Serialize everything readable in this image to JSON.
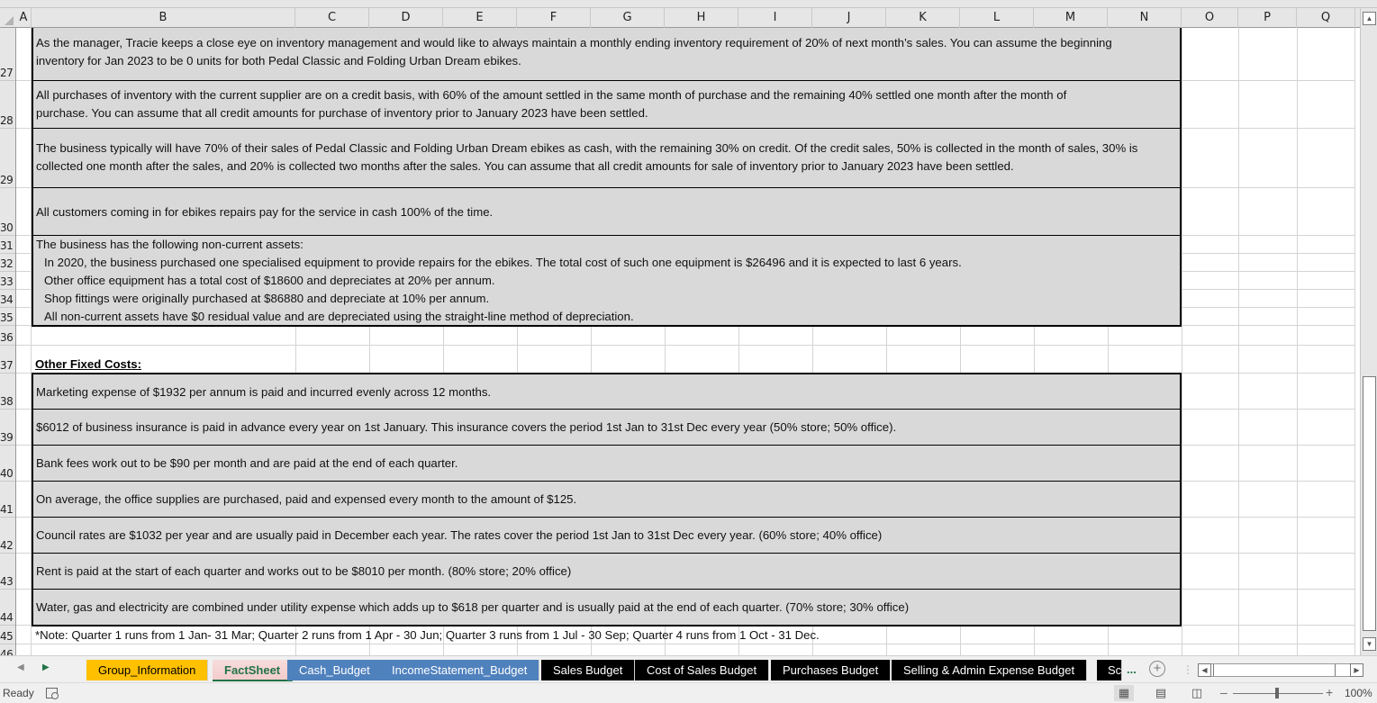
{
  "columns": [
    "A",
    "B",
    "C",
    "D",
    "E",
    "F",
    "G",
    "H",
    "I",
    "J",
    "K",
    "L",
    "M",
    "N",
    "O",
    "P",
    "Q"
  ],
  "rows": [
    "27",
    "28",
    "29",
    "30",
    "31",
    "32",
    "33",
    "34",
    "35",
    "36",
    "37",
    "38",
    "39",
    "40",
    "41",
    "42",
    "43",
    "44",
    "45",
    "46"
  ],
  "cells": {
    "r27": "As the manager, Tracie keeps a close eye on inventory management and would like to always maintain a monthly ending inventory requirement of 20% of next month’s sales. You can assume the beginning",
    "r27b": "inventory for Jan 2023 to be 0 units for both Pedal Classic and Folding Urban Dream ebikes.",
    "r28": "All purchases of inventory with the current supplier are on a credit basis, with 60% of the amount settled in the same month of purchase and the remaining 40% settled one month after the month of",
    "r28b": "purchase. You can assume that all credit amounts for purchase of inventory prior to January 2023 have been settled.",
    "r29": "The business typically will have 70% of their sales of Pedal Classic and Folding Urban Dream ebikes as cash, with the remaining 30% on credit. Of the credit sales, 50% is collected in the month of sales, 30% is",
    "r29b": "collected one month after the sales, and 20% is collected two months after the sales. You can assume that all credit amounts for sale of inventory prior to January 2023 have been settled.",
    "r30": "All customers coming in for ebikes repairs pay for the service in cash 100% of the time.",
    "r31": "The business has the following non-current assets:",
    "r32": "In 2020, the business purchased one specialised equipment to provide repairs for the ebikes. The total cost of such one equipment is $26496 and it is expected to last 6 years.",
    "r33": "Other office equipment has a total cost of $18600 and depreciates at 20% per annum.",
    "r34": "Shop fittings were originally purchased at $86880 and depreciate at 10% per annum.",
    "r35": "All non-current assets have $0 residual value and are depreciated using the straight-line method of depreciation.",
    "r37": "Other Fixed Costs:",
    "r38": "Marketing expense of $1932 per annum is paid and incurred evenly across 12 months.",
    "r39": "$6012 of business insurance is paid in advance every year on 1st January. This insurance covers the period 1st Jan to 31st Dec every year (50% store; 50% office).",
    "r40": "Bank fees work out to be $90 per month and are paid at the end of each quarter.",
    "r41": "On average, the office supplies are purchased, paid and expensed every month to the amount of $125.",
    "r42": "Council rates are $1032 per year and are usually paid in December each year. The rates cover the period 1st Jan to 31st Dec every year. (60% store; 40% office)",
    "r43": "Rent is paid at the start of each quarter and works out to be $8010 per month. (80% store; 20% office)",
    "r44": "Water, gas and electricity are combined under utility expense which adds up to $618 per quarter and is usually paid at the end of each quarter. (70% store; 30% office)",
    "r45": "*Note: Quarter 1 runs from 1 Jan- 31 Mar; Quarter 2 runs from 1 Apr - 30 Jun; Quarter 3 runs from 1 Jul - 30 Sep; Quarter 4 runs from 1 Oct - 31 Dec."
  },
  "sheet_tabs": [
    {
      "label": "Group_Information",
      "bg": "#ffc000",
      "color": "#000000"
    },
    {
      "label": "FactSheet",
      "active": true
    },
    {
      "label": "Cash_Budget",
      "bg": "#4f81bd",
      "color": "#ffffff"
    },
    {
      "label": "IncomeStatement_Budget",
      "bg": "#4f81bd",
      "color": "#ffffff"
    },
    {
      "label": "Sales Budget",
      "bg": "#000000",
      "color": "#ffffff"
    },
    {
      "label": "Cost of Sales Budget",
      "bg": "#000000",
      "color": "#ffffff"
    },
    {
      "label": "Purchases Budget",
      "bg": "#000000",
      "color": "#ffffff"
    },
    {
      "label": "Selling & Admin Expense Budget",
      "bg": "#000000",
      "color": "#ffffff"
    },
    {
      "label": "Sc",
      "bg": "#000000",
      "color": "#ffffff"
    }
  ],
  "tab_more_label": "...",
  "add_sheet_icon": "+",
  "status": {
    "ready": "Ready",
    "zoom_level": "100%",
    "zoom_percent": 100
  },
  "icons": {
    "scroll_up": "▲",
    "scroll_down": "▼",
    "scroll_left": "◀",
    "scroll_right": "▶",
    "normal_view": "▦",
    "page_layout": "▤",
    "page_break": "◫"
  }
}
